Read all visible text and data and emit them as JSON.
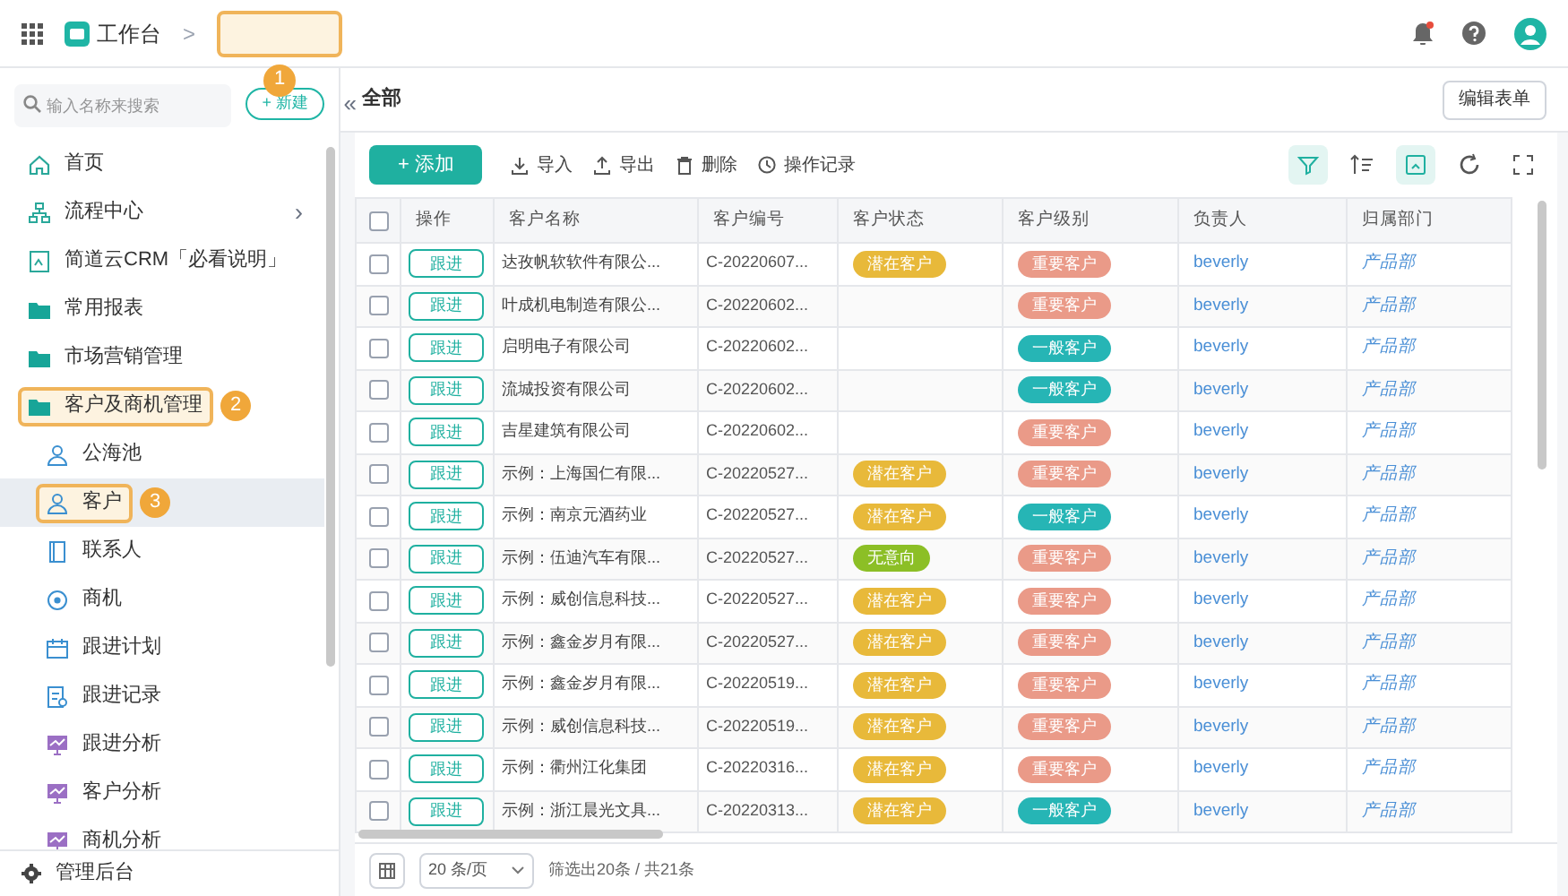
{
  "topbar": {
    "app": "工作台",
    "separator": ">",
    "callout": "1"
  },
  "sidebar": {
    "search_placeholder": "输入名称来搜索",
    "new_button": "+ 新建",
    "collapse": "«",
    "items": [
      {
        "label": "首页",
        "kind": "home",
        "selected": false
      },
      {
        "label": "流程中心",
        "kind": "flow",
        "selected": false,
        "chevron": "›"
      },
      {
        "label": "简道云CRM「必看说明」",
        "kind": "doc",
        "selected": false
      },
      {
        "label": "常用报表",
        "kind": "folder",
        "selected": false
      },
      {
        "label": "市场营销管理",
        "kind": "folder",
        "selected": false
      },
      {
        "label": "客户及商机管理",
        "kind": "folder",
        "selected": false,
        "callout": "2",
        "children": [
          {
            "label": "公海池",
            "kind": "person",
            "selected": false
          },
          {
            "label": "客户",
            "kind": "person",
            "selected": true,
            "callout": "3"
          },
          {
            "label": "联系人",
            "kind": "book",
            "selected": false
          },
          {
            "label": "商机",
            "kind": "target",
            "selected": false
          },
          {
            "label": "跟进计划",
            "kind": "calendar",
            "selected": false
          },
          {
            "label": "跟进记录",
            "kind": "record",
            "selected": false
          },
          {
            "label": "跟进分析",
            "kind": "chart",
            "selected": false
          },
          {
            "label": "客户分析",
            "kind": "chart",
            "selected": false
          },
          {
            "label": "商机分析",
            "kind": "chart",
            "selected": false
          }
        ]
      }
    ],
    "admin": "管理后台"
  },
  "main": {
    "title": "全部",
    "edit_form": "编辑表单",
    "toolbar": [
      {
        "label": "+ 添加",
        "kind": "primary"
      },
      {
        "label": "导入",
        "kind": "import"
      },
      {
        "label": "导出",
        "kind": "export"
      },
      {
        "label": "删除",
        "kind": "delete"
      },
      {
        "label": "操作记录",
        "kind": "history"
      }
    ],
    "tools": [
      {
        "kind": "filter",
        "selected": true
      },
      {
        "kind": "sort",
        "selected": false
      },
      {
        "kind": "view",
        "selected": true
      },
      {
        "kind": "refresh",
        "selected": false
      },
      {
        "kind": "fullscreen",
        "selected": false
      }
    ],
    "table": {
      "select_all_checked": false,
      "columns": [
        "操作",
        "客户名称",
        "客户编号",
        "客户状态",
        "客户级别",
        "负责人",
        "归属部门"
      ],
      "rows": [
        {
          "checked": false,
          "action": "跟进",
          "name": "达孜帆软软件有限公...",
          "code": "C-20220607...",
          "status": {
            "text": "潜在客户",
            "color": "#e8b93a"
          },
          "level": {
            "text": "重要客户",
            "color": "#ea9a88"
          },
          "owner": "beverly",
          "dept": "产品部"
        },
        {
          "checked": false,
          "action": "跟进",
          "name": "叶成机电制造有限公...",
          "code": "C-20220602...",
          "level": {
            "text": "重要客户",
            "color": "#ea9a88"
          },
          "owner": "beverly",
          "dept": "产品部"
        },
        {
          "checked": false,
          "action": "跟进",
          "name": "启明电子有限公司",
          "code": "C-20220602...",
          "level": {
            "text": "一般客户",
            "color": "#26b5b5"
          },
          "owner": "beverly",
          "dept": "产品部"
        },
        {
          "checked": false,
          "action": "跟进",
          "name": "流城投资有限公司",
          "code": "C-20220602...",
          "level": {
            "text": "一般客户",
            "color": "#26b5b5"
          },
          "owner": "beverly",
          "dept": "产品部"
        },
        {
          "checked": false,
          "action": "跟进",
          "name": "吉星建筑有限公司",
          "code": "C-20220602...",
          "level": {
            "text": "重要客户",
            "color": "#ea9a88"
          },
          "owner": "beverly",
          "dept": "产品部"
        },
        {
          "checked": false,
          "action": "跟进",
          "name": "示例：上海国仁有限...",
          "code": "C-20220527...",
          "status": {
            "text": "潜在客户",
            "color": "#e8b93a"
          },
          "level": {
            "text": "重要客户",
            "color": "#ea9a88"
          },
          "owner": "beverly",
          "dept": "产品部"
        },
        {
          "checked": false,
          "action": "跟进",
          "name": "示例：南京元酒药业",
          "code": "C-20220527...",
          "status": {
            "text": "潜在客户",
            "color": "#e8b93a"
          },
          "level": {
            "text": "一般客户",
            "color": "#26b5b5"
          },
          "owner": "beverly",
          "dept": "产品部"
        },
        {
          "checked": false,
          "action": "跟进",
          "name": "示例：伍迪汽车有限...",
          "code": "C-20220527...",
          "status": {
            "text": "无意向",
            "color": "#8cbf26"
          },
          "level": {
            "text": "重要客户",
            "color": "#ea9a88"
          },
          "owner": "beverly",
          "dept": "产品部"
        },
        {
          "checked": false,
          "action": "跟进",
          "name": "示例：威创信息科技...",
          "code": "C-20220527...",
          "status": {
            "text": "潜在客户",
            "color": "#e8b93a"
          },
          "level": {
            "text": "重要客户",
            "color": "#ea9a88"
          },
          "owner": "beverly",
          "dept": "产品部"
        },
        {
          "checked": false,
          "action": "跟进",
          "name": "示例：鑫金岁月有限...",
          "code": "C-20220527...",
          "status": {
            "text": "潜在客户",
            "color": "#e8b93a"
          },
          "level": {
            "text": "重要客户",
            "color": "#ea9a88"
          },
          "owner": "beverly",
          "dept": "产品部"
        },
        {
          "checked": false,
          "action": "跟进",
          "name": "示例：鑫金岁月有限...",
          "code": "C-20220519...",
          "status": {
            "text": "潜在客户",
            "color": "#e8b93a"
          },
          "level": {
            "text": "重要客户",
            "color": "#ea9a88"
          },
          "owner": "beverly",
          "dept": "产品部"
        },
        {
          "checked": false,
          "action": "跟进",
          "name": "示例：威创信息科技...",
          "code": "C-20220519...",
          "status": {
            "text": "潜在客户",
            "color": "#e8b93a"
          },
          "level": {
            "text": "重要客户",
            "color": "#ea9a88"
          },
          "owner": "beverly",
          "dept": "产品部"
        },
        {
          "checked": false,
          "action": "跟进",
          "name": "示例：衢州江化集团",
          "code": "C-20220316...",
          "status": {
            "text": "潜在客户",
            "color": "#e8b93a"
          },
          "level": {
            "text": "重要客户",
            "color": "#ea9a88"
          },
          "owner": "beverly",
          "dept": "产品部"
        },
        {
          "checked": false,
          "action": "跟进",
          "name": "示例：浙江晨光文具...",
          "code": "C-20220313...",
          "status": {
            "text": "潜在客户",
            "color": "#e8b93a"
          },
          "level": {
            "text": "一般客户",
            "color": "#26b5b5"
          },
          "owner": "beverly",
          "dept": "产品部"
        }
      ]
    },
    "footer": {
      "page_size": "20 条/页",
      "summary": "筛选出20条 / 共21条"
    }
  }
}
